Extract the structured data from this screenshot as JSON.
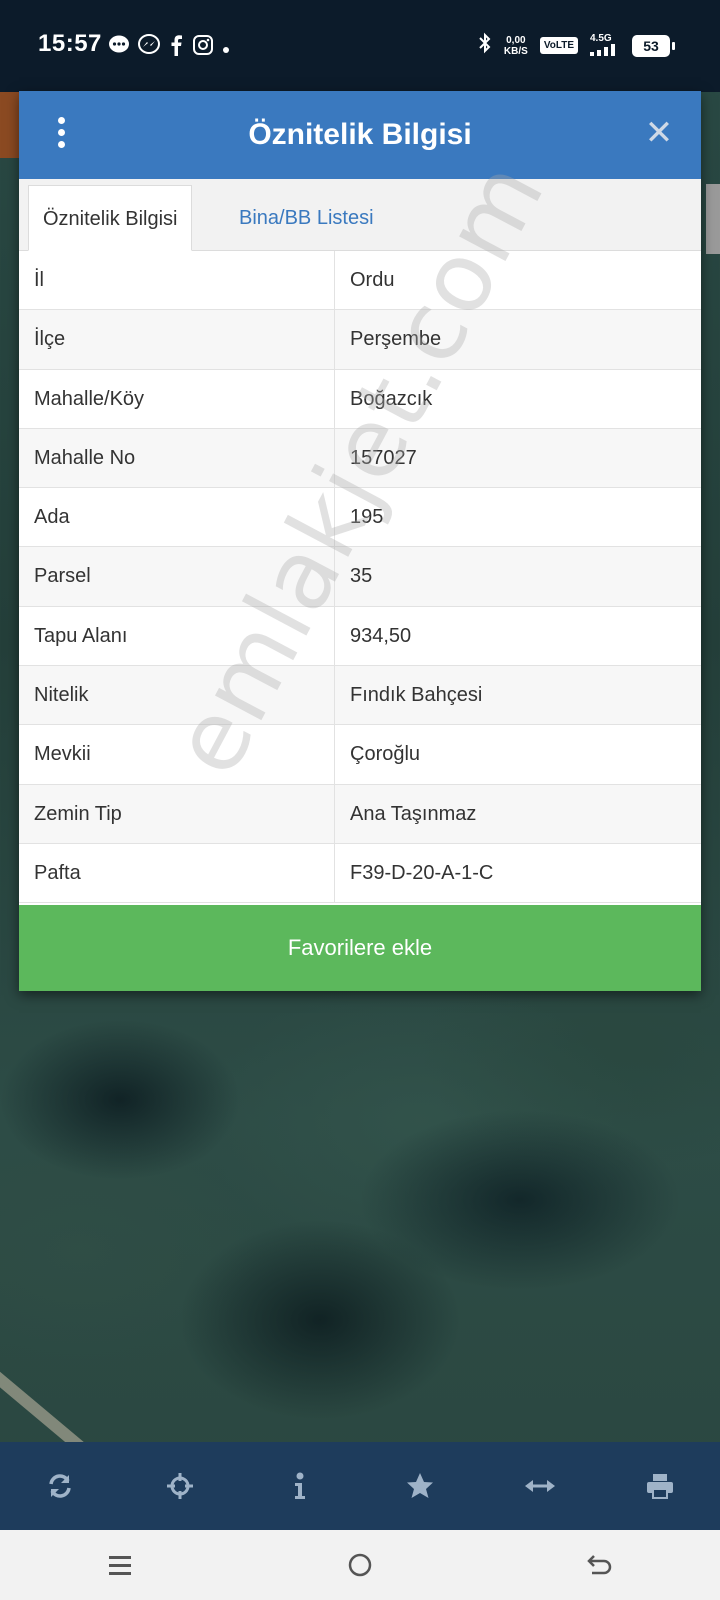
{
  "status_bar": {
    "time": "15:57",
    "notif_icons": [
      "chat-bubble-icon",
      "messenger-icon",
      "facebook-icon",
      "instagram-icon",
      "dot-icon"
    ],
    "speed_value": "0,00",
    "speed_unit": "KB/S",
    "volte": "VoLTE",
    "network": "4.5G",
    "battery": "53"
  },
  "dialog": {
    "title": "Öznitelik Bilgisi",
    "tabs": [
      {
        "label": "Öznitelik Bilgisi",
        "active": true
      },
      {
        "label": "Bina/BB Listesi",
        "active": false
      }
    ],
    "rows": [
      {
        "key": "İl",
        "value": "Ordu"
      },
      {
        "key": "İlçe",
        "value": "Perşembe"
      },
      {
        "key": "Mahalle/Köy",
        "value": "Boğazcık"
      },
      {
        "key": "Mahalle No",
        "value": "157027"
      },
      {
        "key": "Ada",
        "value": "195"
      },
      {
        "key": "Parsel",
        "value": "35"
      },
      {
        "key": "Tapu Alanı",
        "value": "934,50"
      },
      {
        "key": "Nitelik",
        "value": "Fındık Bahçesi"
      },
      {
        "key": "Mevkii",
        "value": "Çoroğlu"
      },
      {
        "key": "Zemin Tip",
        "value": "Ana Taşınmaz"
      },
      {
        "key": "Pafta",
        "value": "F39-D-20-A-1-C"
      }
    ],
    "favorite_button": "Favorilere ekle"
  },
  "watermark": "emlakjet.com",
  "toolbar": {
    "icons": [
      "refresh-icon",
      "crosshair-icon",
      "info-icon",
      "star-icon",
      "measure-icon",
      "print-icon"
    ]
  },
  "colors": {
    "header": "#3a79bf",
    "button_green": "#5cb85c",
    "toolbar": "#1e3c5c"
  }
}
